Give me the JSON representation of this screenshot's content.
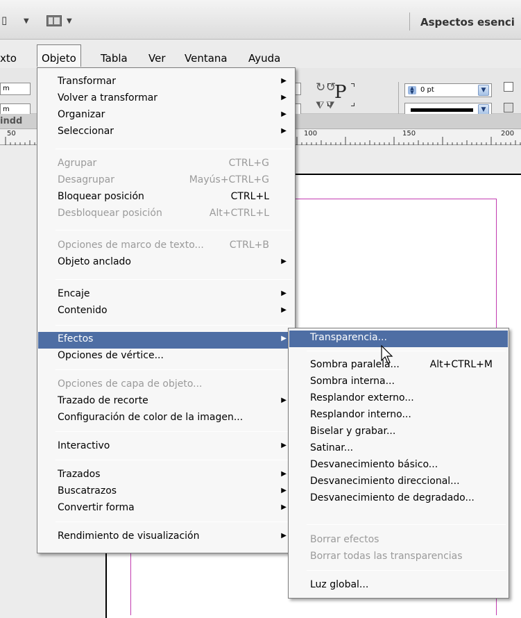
{
  "toolbar": {
    "workspace_label": "Aspectos esenci"
  },
  "menubar": {
    "items": [
      "xto",
      "Objeto",
      "Tabla",
      "Ver",
      "Ventana",
      "Ayuda"
    ]
  },
  "control_panel": {
    "field_a": "m",
    "field_b": "m",
    "stroke_weight": "0 pt"
  },
  "document_tab": {
    "label": "indd"
  },
  "ruler": {
    "ticks": [
      "50",
      "100",
      "150",
      "200"
    ]
  },
  "object_menu": {
    "items": [
      {
        "label": "Transformar",
        "submenu": true
      },
      {
        "label": "Volver a transformar",
        "submenu": true
      },
      {
        "label": "Organizar",
        "submenu": true
      },
      {
        "label": "Seleccionar",
        "submenu": true
      },
      {
        "label": "Agrupar",
        "shortcut": "CTRL+G",
        "disabled": true
      },
      {
        "label": "Desagrupar",
        "shortcut": "Mayús+CTRL+G",
        "disabled": true
      },
      {
        "label": "Bloquear posición",
        "shortcut": "CTRL+L"
      },
      {
        "label": "Desbloquear posición",
        "shortcut": "Alt+CTRL+L",
        "disabled": true
      },
      {
        "label": "Opciones de marco de texto...",
        "shortcut": "CTRL+B",
        "disabled": true
      },
      {
        "label": "Objeto anclado",
        "submenu": true
      },
      {
        "label": "Encaje",
        "submenu": true
      },
      {
        "label": "Contenido",
        "submenu": true
      },
      {
        "label": "Efectos",
        "submenu": true,
        "highlighted": true
      },
      {
        "label": "Opciones de vértice..."
      },
      {
        "label": "Opciones de capa de objeto...",
        "disabled": true
      },
      {
        "label": "Trazado de recorte",
        "submenu": true
      },
      {
        "label": "Configuración de color de la imagen..."
      },
      {
        "label": "Interactivo",
        "submenu": true
      },
      {
        "label": "Trazados",
        "submenu": true
      },
      {
        "label": "Buscatrazos",
        "submenu": true
      },
      {
        "label": "Convertir forma",
        "submenu": true
      },
      {
        "label": "Rendimiento de visualización",
        "submenu": true
      }
    ]
  },
  "effects_menu": {
    "items": [
      {
        "label": "Transparencia...",
        "highlighted": true
      },
      {
        "label": "Sombra paralela...",
        "shortcut": "Alt+CTRL+M"
      },
      {
        "label": "Sombra interna..."
      },
      {
        "label": "Resplandor externo..."
      },
      {
        "label": "Resplandor interno..."
      },
      {
        "label": "Biselar y grabar..."
      },
      {
        "label": "Satinar..."
      },
      {
        "label": "Desvanecimiento básico..."
      },
      {
        "label": "Desvanecimiento direccional..."
      },
      {
        "label": "Desvanecimiento de degradado..."
      },
      {
        "label": "Borrar efectos",
        "disabled": true
      },
      {
        "label": "Borrar todas las transparencias",
        "disabled": true
      },
      {
        "label": "Luz global..."
      }
    ]
  },
  "colors": {
    "menu_highlight": "#4e6ea4",
    "margin_guide": "#c23bb0"
  }
}
